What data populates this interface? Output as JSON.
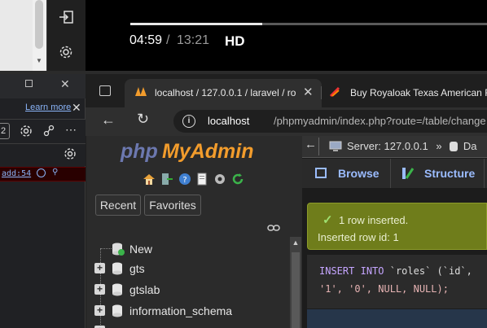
{
  "video": {
    "current_time": "04:59",
    "separator": "/",
    "total_time": "13:21",
    "quality": "HD",
    "progress": 0.37
  },
  "devtools": {
    "learn_more": "Learn more",
    "input_value": "2",
    "error_link": "add:54"
  },
  "browser": {
    "tabs": [
      {
        "title": "localhost / 127.0.0.1 / laravel / ro"
      },
      {
        "title": "Buy Royaloak Texas American Fa"
      }
    ],
    "url_host": "localhost",
    "url_path": "/phpmyadmin/index.php?route=/table/change"
  },
  "pma": {
    "logo_php": "php",
    "logo_myadmin": "MyAdmin",
    "recent": "Recent",
    "favorites": "Favorites",
    "tree": [
      {
        "label": "New"
      },
      {
        "label": "gts"
      },
      {
        "label": "gtslab"
      },
      {
        "label": "information_schema"
      }
    ],
    "server": "Server: 127.0.0.1",
    "server_sep": "»",
    "server_next": "Da",
    "tab_browse": "Browse",
    "tab_structure": "Structure",
    "success_message": "1 row inserted.",
    "inserted_id": "Inserted row id: 1",
    "sql": {
      "line1_kw1": "INSERT",
      "line1_kw2": "INTO",
      "line1_rest": "`roles` (`id`,",
      "line2": "'1', '0', NULL, NULL);"
    }
  },
  "colors": {
    "success_bg": "#6f7d1b",
    "link": "#8ab4f8",
    "pma_blue": "#6c78af",
    "pma_orange": "#f29c2c"
  }
}
